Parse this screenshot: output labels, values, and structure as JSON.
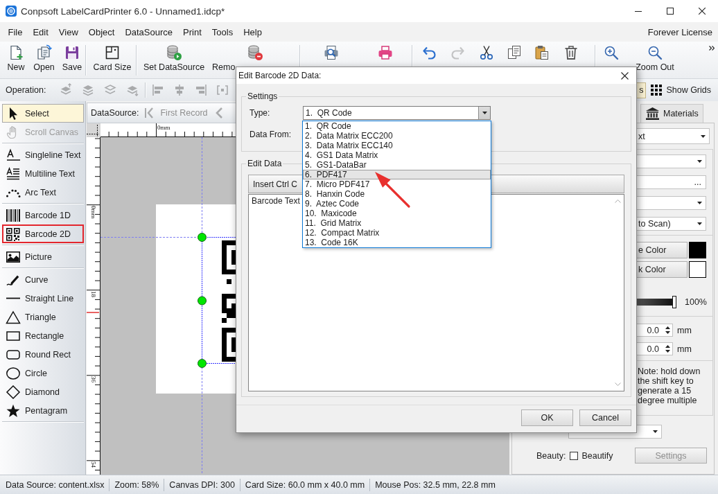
{
  "window": {
    "title": "Conpsoft LabelCardPrinter 6.0 - Unnamed1.idcp*"
  },
  "menu": {
    "items": [
      "File",
      "Edit",
      "View",
      "Object",
      "DataSource",
      "Print",
      "Tools",
      "Help"
    ],
    "license": "Forever License"
  },
  "toolbar": {
    "buttons": [
      {
        "label": "New",
        "disabled": false
      },
      {
        "label": "Open",
        "disabled": false
      },
      {
        "label": "Save",
        "disabled": false
      },
      {
        "label": "Card Size",
        "disabled": false
      },
      {
        "label": "Set DataSource",
        "disabled": false
      },
      {
        "label": "Remo",
        "disabled": false
      },
      {
        "disabled": false
      },
      {
        "disabled": false
      },
      {
        "disabled": false
      },
      {
        "disabled": true
      },
      {
        "disabled": false
      },
      {
        "disabled": false
      },
      {
        "disabled": false
      },
      {
        "disabled": false
      },
      {
        "disabled": false
      },
      {
        "label": "Zoom Out",
        "disabled": false
      }
    ]
  },
  "operation_bar": {
    "label": "Operation:",
    "tools": [
      {
        "disabled": true
      },
      {
        "disabled": true
      },
      {
        "disabled": true
      },
      {
        "disabled": true
      },
      {
        "disabled": true
      },
      {
        "disabled": true
      },
      {
        "disabled": true
      },
      {
        "disabled": true
      }
    ],
    "toggles": [
      {
        "label": "s",
        "on": true
      },
      {
        "label": "Show Grids",
        "on": false
      }
    ]
  },
  "toolbox": {
    "groups": [
      [
        {
          "label": "Select",
          "selected": true,
          "disabled": false,
          "highlighted": false
        },
        {
          "label": "Scroll Canvas",
          "selected": false,
          "disabled": true,
          "highlighted": false
        }
      ],
      [
        {
          "label": "Singleline Text",
          "selected": false,
          "disabled": false,
          "highlighted": false
        },
        {
          "label": "Multiline Text",
          "selected": false,
          "disabled": false,
          "highlighted": false
        },
        {
          "label": "Arc Text",
          "selected": false,
          "disabled": false,
          "highlighted": false
        }
      ],
      [
        {
          "label": "Barcode 1D",
          "selected": false,
          "disabled": false,
          "highlighted": false
        },
        {
          "label": "Barcode 2D",
          "selected": false,
          "disabled": false,
          "highlighted": true
        }
      ],
      [
        {
          "label": "Picture",
          "selected": false,
          "disabled": false,
          "highlighted": false
        }
      ],
      [
        {
          "label": "Curve",
          "selected": false,
          "disabled": false,
          "highlighted": false
        },
        {
          "label": "Straight Line",
          "selected": false,
          "disabled": false,
          "highlighted": false
        },
        {
          "label": "Triangle",
          "selected": false,
          "disabled": false,
          "highlighted": false
        },
        {
          "label": "Rectangle",
          "selected": false,
          "disabled": false,
          "highlighted": false
        },
        {
          "label": "Round Rect",
          "selected": false,
          "disabled": false,
          "highlighted": false
        },
        {
          "label": "Circle",
          "selected": false,
          "disabled": false,
          "highlighted": false
        },
        {
          "label": "Diamond",
          "selected": false,
          "disabled": false,
          "highlighted": false
        },
        {
          "label": "Pentagram",
          "selected": false,
          "disabled": false,
          "highlighted": false
        }
      ]
    ]
  },
  "record_bar": {
    "label": "DataSource:",
    "buttons": [
      {
        "label": "First Record",
        "disabled": true
      },
      {
        "disabled": true
      }
    ]
  },
  "rulers": {
    "horizontal": [
      "0mm"
    ],
    "vertical": [
      "0mm",
      "18",
      "36",
      "54"
    ]
  },
  "properties": {
    "tabs": [
      {
        "label": "Materials",
        "selected": false
      }
    ],
    "header": [
      {
        "kind": "dropdown",
        "value": "xt"
      }
    ],
    "groups": [
      [
        {
          "kind": "dropdown"
        },
        {
          "kind": "browse",
          "button": "..."
        },
        {
          "kind": "dropdown"
        },
        {
          "kind": "dropdown",
          "value": "to Scan)"
        }
      ],
      [
        {
          "kind": "color",
          "label": "e Color",
          "color": "#000000"
        },
        {
          "kind": "color",
          "label": "k Color",
          "color": "#ffffff"
        },
        {
          "kind": "slider",
          "level": 1,
          "reading": "100%"
        }
      ],
      [
        {
          "kind": "spin",
          "value": "0.0",
          "unit": "mm"
        },
        {
          "kind": "spin",
          "value": "0.0",
          "unit": "mm"
        }
      ],
      [
        {
          "kind": "note",
          "text": "Note: hold down the shift key to generate a 15 degree multiple"
        }
      ]
    ],
    "footer": [
      {
        "kind": "dropdown"
      },
      {
        "kind": "checkbox",
        "label": "Beauty:",
        "text": "Beautify",
        "checked": false
      },
      {
        "kind": "button",
        "label": "Settings",
        "disabled": true
      }
    ]
  },
  "status_bar": {
    "items": [
      "Data Source: content.xlsx",
      "Zoom: 58%",
      "Canvas DPI: 300",
      "Card Size: 60.0 mm x 40.0 mm",
      "Mouse Pos: 32.5 mm, 22.8 mm"
    ]
  },
  "dialog": {
    "title": "Edit Barcode 2D Data:",
    "settings": {
      "legend": "Settings",
      "type": {
        "label": "Type:",
        "value": "1.  QR Code",
        "expanded": true,
        "options": [
          {
            "label": "1.  QR Code",
            "highlighted": false
          },
          {
            "label": "2.  Data Matrix ECC200",
            "highlighted": false
          },
          {
            "label": "3.  Data Matrix ECC140",
            "highlighted": false
          },
          {
            "label": "4.  GS1 Data Matrix",
            "highlighted": false
          },
          {
            "label": "5.  GS1-DataBar",
            "highlighted": false
          },
          {
            "label": "6.  PDF417",
            "highlighted": true
          },
          {
            "label": "7.  Micro PDF417",
            "highlighted": false
          },
          {
            "label": "8.  Hanxin Code",
            "highlighted": false
          },
          {
            "label": "9.  Aztec Code",
            "highlighted": false
          },
          {
            "label": "10.  Maxicode",
            "highlighted": false
          },
          {
            "label": "11.  Grid Matrix",
            "highlighted": false
          },
          {
            "label": "12.  Compact Matrix",
            "highlighted": false
          },
          {
            "label": "13.  Code 16K",
            "highlighted": false
          }
        ]
      },
      "data_from": {
        "label": "Data From:"
      }
    },
    "edit_data": {
      "legend": "Edit Data",
      "insert_button": "Insert Ctrl C",
      "text": "Barcode Text"
    },
    "buttons": [
      "OK",
      "Cancel"
    ]
  }
}
